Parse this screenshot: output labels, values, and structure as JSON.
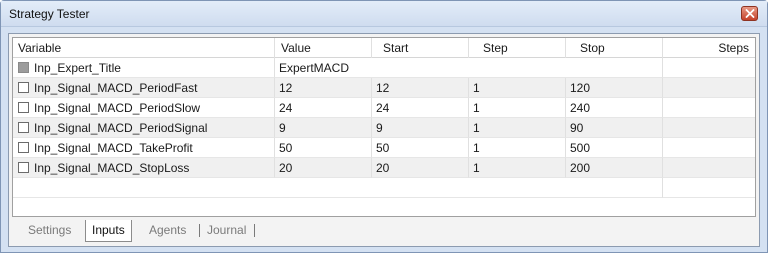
{
  "window": {
    "title": "Strategy Tester"
  },
  "table": {
    "columns": [
      "Variable",
      "Value",
      "Start",
      "Step",
      "Stop",
      "Steps"
    ],
    "rows": [
      {
        "variable": "Inp_Expert_Title",
        "value": "ExpertMACD",
        "start": "",
        "step": "",
        "stop": "",
        "steps": "",
        "checked": false,
        "enabled": false
      },
      {
        "variable": "Inp_Signal_MACD_PeriodFast",
        "value": "12",
        "start": "12",
        "step": "1",
        "stop": "120",
        "steps": "",
        "checked": false,
        "enabled": true
      },
      {
        "variable": "Inp_Signal_MACD_PeriodSlow",
        "value": "24",
        "start": "24",
        "step": "1",
        "stop": "240",
        "steps": "",
        "checked": false,
        "enabled": true
      },
      {
        "variable": "Inp_Signal_MACD_PeriodSignal",
        "value": "9",
        "start": "9",
        "step": "1",
        "stop": "90",
        "steps": "",
        "checked": false,
        "enabled": true
      },
      {
        "variable": "Inp_Signal_MACD_TakeProfit",
        "value": "50",
        "start": "50",
        "step": "1",
        "stop": "500",
        "steps": "",
        "checked": false,
        "enabled": true
      },
      {
        "variable": "Inp_Signal_MACD_StopLoss",
        "value": "20",
        "start": "20",
        "step": "1",
        "stop": "200",
        "steps": "",
        "checked": false,
        "enabled": true
      }
    ]
  },
  "tabs": [
    {
      "label": "Settings",
      "active": false
    },
    {
      "label": "Inputs",
      "active": true
    },
    {
      "label": "Agents",
      "active": false
    },
    {
      "label": "Journal",
      "active": false
    }
  ],
  "icons": {
    "close": "close-icon"
  },
  "colors": {
    "title_bar": "#cfdcef",
    "close_button": "#c4412a",
    "row_alt": "#f0f0f0"
  }
}
